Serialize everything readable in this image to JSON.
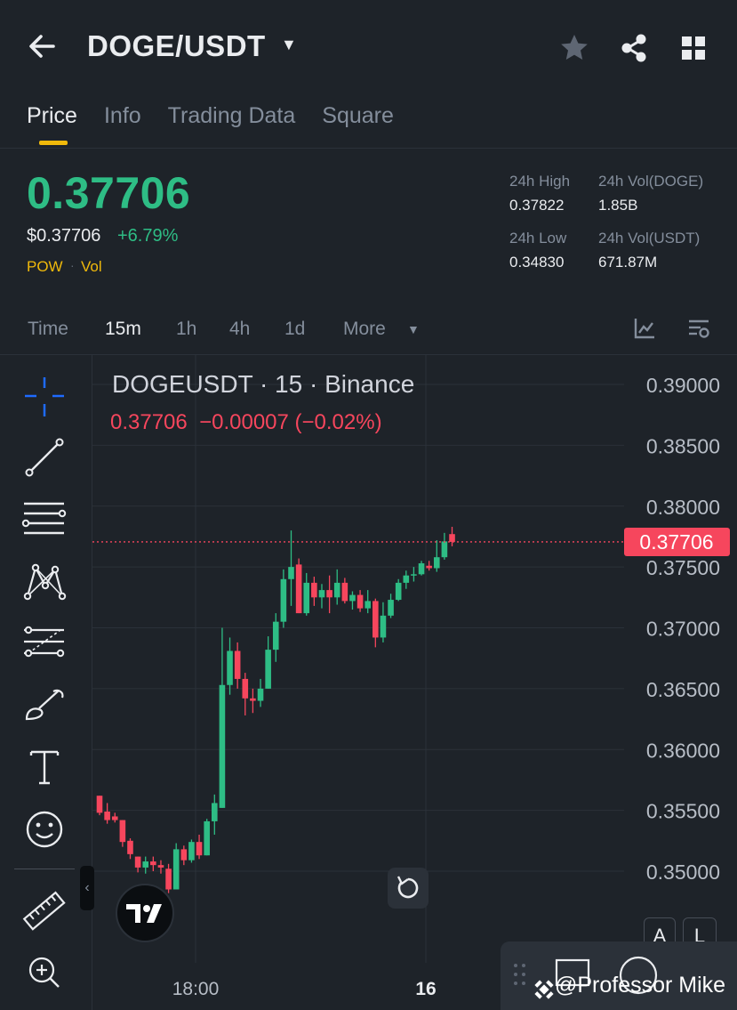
{
  "header": {
    "pair": "DOGE/USDT",
    "back_icon": "arrow-left-icon",
    "star_icon": "star-icon",
    "share_icon": "share-icon",
    "grid_icon": "grid-icon"
  },
  "tabs": [
    {
      "label": "Price",
      "active": true
    },
    {
      "label": "Info",
      "active": false
    },
    {
      "label": "Trading Data",
      "active": false
    },
    {
      "label": "Square",
      "active": false
    }
  ],
  "ticker": {
    "last_price": "0.37706",
    "usd_price": "$0.37706",
    "change_pct": "+6.79%",
    "tag_pow": "POW",
    "tag_vol": "Vol",
    "high_label": "24h High",
    "high_value": "0.37822",
    "vol_doge_label": "24h Vol(DOGE)",
    "vol_doge_value": "1.85B",
    "low_label": "24h Low",
    "low_value": "0.34830",
    "vol_usdt_label": "24h Vol(USDT)",
    "vol_usdt_value": "671.87M"
  },
  "intervals": {
    "items": [
      "Time",
      "15m",
      "1h",
      "4h",
      "1d",
      "More"
    ],
    "active": "15m"
  },
  "chart": {
    "title": "DOGEUSDT · 15 · Binance",
    "ohlc_line": "0.37706  −0.00007 (−0.02%)",
    "current_price_label": "0.37706",
    "y_ticks": [
      "0.39000",
      "0.38500",
      "0.38000",
      "0.37500",
      "0.37000",
      "0.36500",
      "0.36000",
      "0.35500",
      "0.35000"
    ],
    "x_ticks": [
      "18:00",
      "16"
    ],
    "scale_buttons": {
      "auto": "A",
      "log": "L"
    },
    "watermark": "@Professor Mike",
    "colors": {
      "up": "#2ebd85",
      "down": "#f6465d",
      "bg": "#1e2329",
      "grid": "#2b3139"
    }
  },
  "chart_data": {
    "type": "candlestick",
    "title": "DOGEUSDT · 15 · Binance",
    "interval": "15",
    "ylim": [
      0.3465,
      0.3913
    ],
    "y_ticks": [
      0.39,
      0.385,
      0.38,
      0.375,
      0.37,
      0.365,
      0.36,
      0.355,
      0.35
    ],
    "x_tick_labels": [
      "18:00",
      "16"
    ],
    "last_price": 0.37706,
    "candles": [
      [
        0.3562,
        0.3562,
        0.3546,
        0.3548
      ],
      [
        0.3549,
        0.3556,
        0.3539,
        0.3542
      ],
      [
        0.3545,
        0.3548,
        0.354,
        0.3542
      ],
      [
        0.3542,
        0.3542,
        0.352,
        0.3524
      ],
      [
        0.3525,
        0.3527,
        0.351,
        0.3514
      ],
      [
        0.3512,
        0.3512,
        0.3499,
        0.3503
      ],
      [
        0.3503,
        0.3512,
        0.3498,
        0.3508
      ],
      [
        0.3508,
        0.3512,
        0.35,
        0.3505
      ],
      [
        0.3505,
        0.3509,
        0.3498,
        0.3503
      ],
      [
        0.3502,
        0.3506,
        0.3482,
        0.3485
      ],
      [
        0.3485,
        0.3523,
        0.3485,
        0.3518
      ],
      [
        0.3518,
        0.3521,
        0.3505,
        0.3509
      ],
      [
        0.3509,
        0.3526,
        0.3507,
        0.3524
      ],
      [
        0.3524,
        0.353,
        0.351,
        0.3513
      ],
      [
        0.3513,
        0.3543,
        0.3513,
        0.3541
      ],
      [
        0.3541,
        0.3563,
        0.353,
        0.3556
      ],
      [
        0.3552,
        0.37,
        0.3552,
        0.3653
      ],
      [
        0.3653,
        0.3692,
        0.3645,
        0.3681
      ],
      [
        0.3681,
        0.3688,
        0.365,
        0.3658
      ],
      [
        0.3658,
        0.3663,
        0.3628,
        0.3642
      ],
      [
        0.3642,
        0.365,
        0.363,
        0.364
      ],
      [
        0.364,
        0.3658,
        0.3635,
        0.365
      ],
      [
        0.365,
        0.3693,
        0.365,
        0.3682
      ],
      [
        0.3682,
        0.3712,
        0.3672,
        0.3705
      ],
      [
        0.3705,
        0.3748,
        0.37,
        0.374
      ],
      [
        0.374,
        0.378,
        0.3718,
        0.375
      ],
      [
        0.3752,
        0.3757,
        0.3712,
        0.3712
      ],
      [
        0.3712,
        0.3745,
        0.371,
        0.3737
      ],
      [
        0.3737,
        0.3742,
        0.3718,
        0.3725
      ],
      [
        0.3725,
        0.3736,
        0.3716,
        0.3731
      ],
      [
        0.3731,
        0.3743,
        0.3712,
        0.3725
      ],
      [
        0.3725,
        0.3748,
        0.3719,
        0.3737
      ],
      [
        0.3737,
        0.3741,
        0.372,
        0.3722
      ],
      [
        0.3722,
        0.373,
        0.3715,
        0.3727
      ],
      [
        0.3727,
        0.3731,
        0.3713,
        0.3716
      ],
      [
        0.3716,
        0.3731,
        0.3712,
        0.3722
      ],
      [
        0.3722,
        0.3724,
        0.3684,
        0.3692
      ],
      [
        0.3692,
        0.3721,
        0.3688,
        0.371
      ],
      [
        0.371,
        0.3728,
        0.3708,
        0.3723
      ],
      [
        0.3723,
        0.374,
        0.3722,
        0.3737
      ],
      [
        0.3737,
        0.3747,
        0.3732,
        0.3743
      ],
      [
        0.3743,
        0.375,
        0.3738,
        0.3744
      ],
      [
        0.3744,
        0.3755,
        0.3743,
        0.3753
      ],
      [
        0.3751,
        0.3755,
        0.3747,
        0.3749
      ],
      [
        0.3749,
        0.3772,
        0.3746,
        0.3758
      ],
      [
        0.3758,
        0.3778,
        0.3756,
        0.3771
      ],
      [
        0.3777,
        0.3783,
        0.3767,
        0.37706
      ]
    ]
  }
}
